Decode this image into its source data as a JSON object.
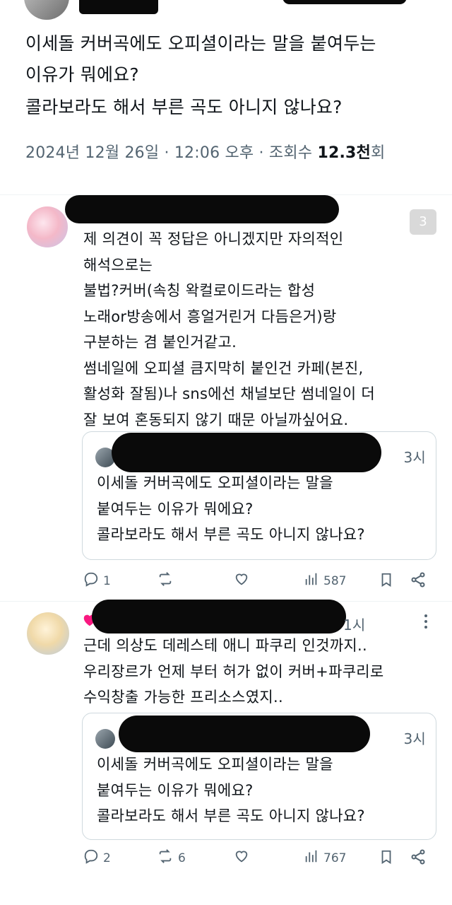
{
  "main_tweet": {
    "lines": [
      "이세돌 커버곡에도 오피셜이라는 말을 붙여두는",
      "이유가 뭐에요?",
      "콜라보라도 해서 부른 곡도 아니지 않나요?"
    ],
    "meta_prefix": "2024년 12월 26일 · 12:06 오후 · 조회수 ",
    "views_number": "12.3천",
    "views_suffix": "회"
  },
  "reply1": {
    "badge": "3",
    "lines": [
      "제 의견이 꼭 정답은 아니겠지만 자의적인",
      "해석으로는",
      "불법?커버(속칭 왁컬로이드라는 합성",
      "노래or방송에서 흥얼거린거 다듬은거)랑",
      "구분하는 겸 붙인거같고.",
      "썸네일에 오피셜 큼지막히 붙인건 카페(본진,",
      "활성화 잘됨)나 sns에선 채널보단 썸네일이 더",
      "잘 보여 혼동되지 않기 때문 아닐까싶어요."
    ],
    "quote": {
      "time": "3시",
      "lines": [
        "이세돌 커버곡에도 오피셜이라는 말을",
        "붙여두는 이유가 뭐에요?",
        "콜라보라도 해서 부른 곡도 아니지 않나요?"
      ]
    },
    "actions": {
      "replies": "1",
      "reposts": "",
      "views": "587"
    },
    "icons": [
      "reply-icon",
      "repost-icon",
      "like-icon",
      "views-icon",
      "bookmark-icon",
      "share-icon"
    ]
  },
  "reply2": {
    "time": "1시",
    "lines": [
      "근데 의상도 데레스테 애니 파쿠리 인것까지..",
      "우리장르가 언제 부터 허가 없이 커버+파쿠리로",
      "수익창출 가능한 프리소스였지.."
    ],
    "quote": {
      "time": "3시",
      "lines": [
        "이세돌 커버곡에도 오피셜이라는 말을",
        "붙여두는 이유가 뭐에요?",
        "콜라보라도 해서 부른 곡도 아니지 않나요?"
      ]
    },
    "actions": {
      "replies": "2",
      "reposts": "6",
      "views": "767"
    },
    "icons": [
      "heart-icon",
      "more-icon",
      "reply-icon",
      "repost-icon",
      "like-icon",
      "views-icon",
      "bookmark-icon",
      "share-icon"
    ]
  },
  "colors": {
    "text": "#0f1419",
    "secondary": "#536471",
    "border": "#cfd9de",
    "redaction": "#0a0a0a",
    "heart": "#f91880"
  }
}
